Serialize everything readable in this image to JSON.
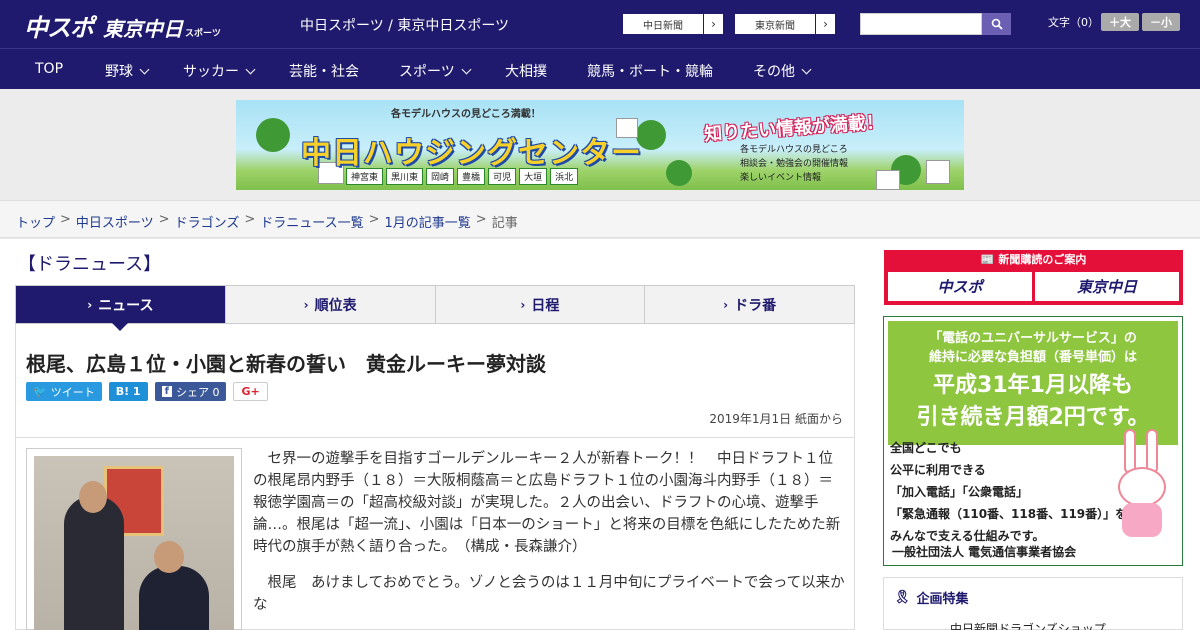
{
  "header": {
    "logo_main": "中スポ",
    "logo_sub": "東京中日",
    "logo_small": "スポーツ",
    "site_title": "中日スポーツ / 東京中日スポーツ",
    "link1": "中日新聞",
    "link2": "東京新聞",
    "font_label": "文字（0）",
    "font_plus": "＋大",
    "font_minus": "－小"
  },
  "nav": {
    "items": [
      {
        "label": "TOP",
        "dropdown": false
      },
      {
        "label": "野球",
        "dropdown": true
      },
      {
        "label": "サッカー",
        "dropdown": true
      },
      {
        "label": "芸能・社会",
        "dropdown": false
      },
      {
        "label": "スポーツ",
        "dropdown": true
      },
      {
        "label": "大相撲",
        "dropdown": false
      },
      {
        "label": "競馬・ボート・競輪",
        "dropdown": false
      },
      {
        "label": "その他",
        "dropdown": true
      }
    ]
  },
  "banner": {
    "top_text": "各モデルハウスの見どころ満載！",
    "title": "中日ハウジングセンター",
    "catch": "知りたい情報が満載！",
    "info1": "各モデルハウスの見どころ",
    "info2": "相談会・勉強会の開催情報",
    "info3": "楽しいイベント情報",
    "areas": [
      "神宮東",
      "黒川東",
      "岡崎",
      "豊橋",
      "可児",
      "大垣",
      "浜北"
    ]
  },
  "breadcrumb": {
    "items": [
      "トップ",
      "中日スポーツ",
      "ドラゴンズ",
      "ドラニュース一覧",
      "1月の記事一覧"
    ],
    "current": "記事",
    "sep": ">"
  },
  "section": {
    "title": "【ドラニュース】"
  },
  "tabs": [
    {
      "label": "ニュース",
      "active": true
    },
    {
      "label": "順位表",
      "active": false
    },
    {
      "label": "日程",
      "active": false
    },
    {
      "label": "ドラ番",
      "active": false
    }
  ],
  "article": {
    "headline": "根尾、広島１位・小園と新春の誓い　黄金ルーキー夢対談",
    "tweet": "ツイート",
    "hatena": "B! 1",
    "share": "シェア 0",
    "gplus": "G+",
    "date": "2019年1月1日 紙面から",
    "para1": "セ界一の遊撃手を目指すゴールデンルーキー２人が新春トーク！！　中日ドラフト１位の根尾昂内野手（１８）＝大阪桐蔭高＝と広島ドラフト１位の小園海斗内野手（１８）＝報徳学園高＝の「超高校級対談」が実現した。２人の出会い、ドラフトの心境、遊撃手論…。根尾は「超一流」、小園は「日本一のショート」と将来の目標を色紙にしたためた新時代の旗手が熱く語り合った。　（構成・長森謙介）",
    "para2": "根尾　あけましておめでとう。ゾノと会うのは１１月中旬にプライベートで会って以来かな"
  },
  "sidebar": {
    "sub_head": "新聞購読のご案内",
    "sub_logo1": "中スポ",
    "sub_logo2": "東京中日",
    "ad_line1": "「電話のユニバーサルサービス」の",
    "ad_line2": "維持に必要な負担額（番号単価）は",
    "ad_line3": "平成31年1月以降も",
    "ad_line4": "引き続き月額2円です。",
    "ad_b1": "全国どこでも",
    "ad_b2": "公平に利用できる",
    "ad_b3": "「加入電話」「公衆電話」",
    "ad_b4": "「緊急通報（110番、118番、119番）」を",
    "ad_b5": "みんなで支える仕組みです。",
    "ad_org": "一般社団法人 電気通信事業者協会",
    "kikaku": "企画特集",
    "kikaku_item": "中日新聞ドラゴンズショップ"
  },
  "colors": {
    "brand": "#1f1a6e",
    "accent": "#e5103a",
    "ad_green": "#8fc63f"
  }
}
